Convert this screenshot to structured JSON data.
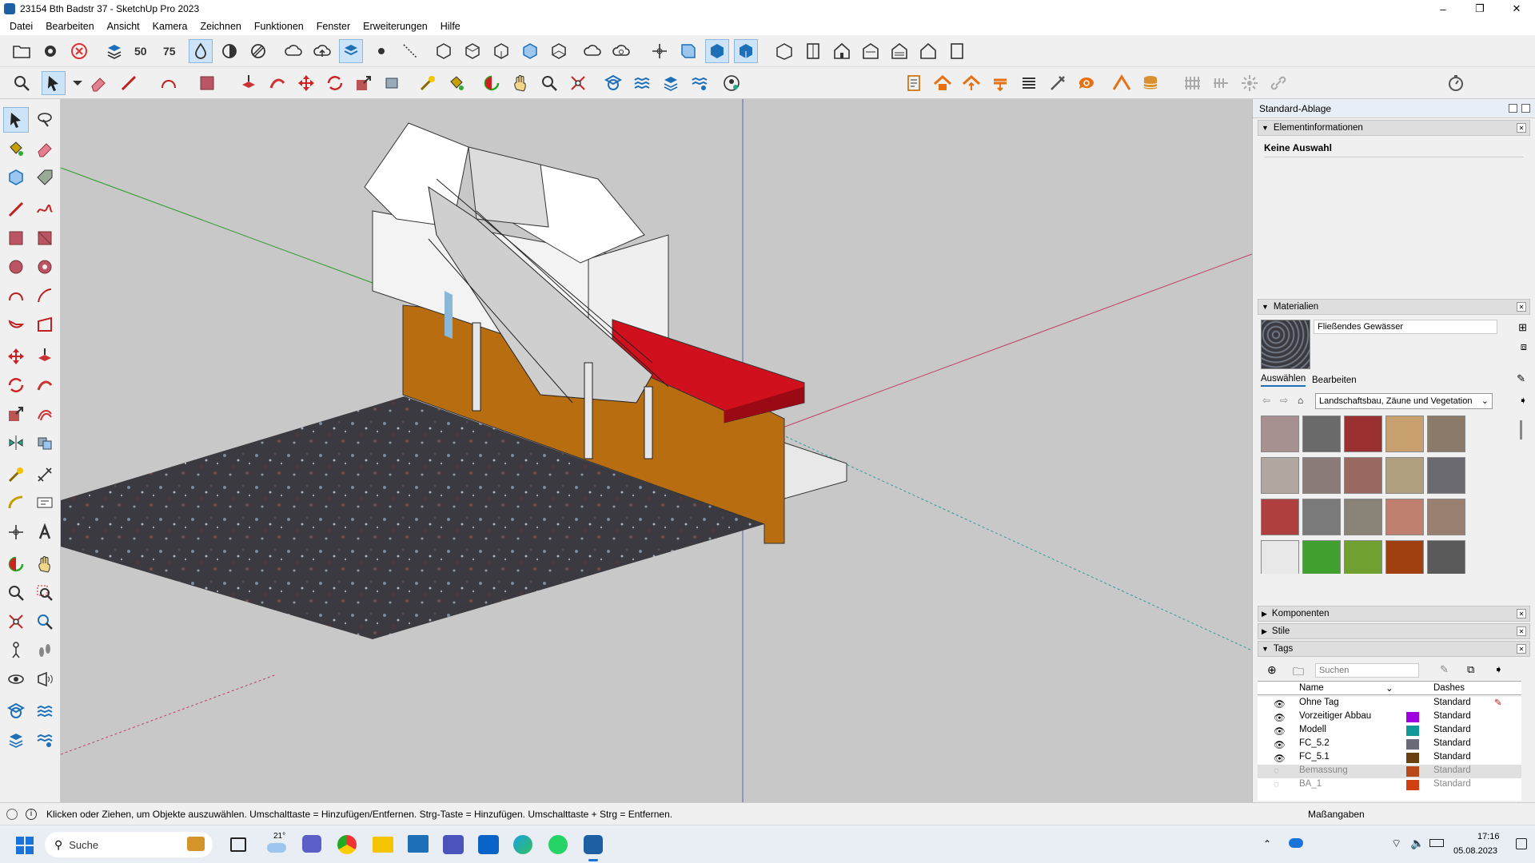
{
  "window": {
    "title": "23154 Bth Badstr 37 - SketchUp Pro 2023",
    "minimize": "–",
    "maximize": "❐",
    "close": "✕"
  },
  "menu": [
    "Datei",
    "Bearbeiten",
    "Ansicht",
    "Kamera",
    "Zeichnen",
    "Funktionen",
    "Fenster",
    "Erweiterungen",
    "Hilfe"
  ],
  "toolbar1": {
    "text_50": "50",
    "text_75": "75"
  },
  "tray": {
    "title": "Standard-Ablage",
    "entity_info": {
      "header": "Elementinformationen",
      "selection": "Keine Auswahl"
    },
    "materials": {
      "header": "Materialien",
      "current_name": "Fließendes Gewässer",
      "tab_select": "Auswählen",
      "tab_edit": "Bearbeiten",
      "library": "Landschaftsbau, Zäune und Vegetation"
    },
    "components": "Komponenten",
    "styles": "Stile",
    "tags": {
      "header": "Tags",
      "search_placeholder": "Suchen",
      "col_name": "Name",
      "col_dashes": "Dashes",
      "rows": [
        {
          "name": "Ohne Tag",
          "color": "",
          "dashes": "Standard",
          "visible": true
        },
        {
          "name": "Vorzeitiger Abbau",
          "color": "#a000e0",
          "dashes": "Standard",
          "visible": true
        },
        {
          "name": "Modell",
          "color": "#109898",
          "dashes": "Standard",
          "visible": true
        },
        {
          "name": "FC_5.2",
          "color": "#6a6a7a",
          "dashes": "Standard",
          "visible": true
        },
        {
          "name": "FC_5.1",
          "color": "#6a4010",
          "dashes": "Standard",
          "visible": true
        },
        {
          "name": "Bemassung",
          "color": "#b84818",
          "dashes": "Standard",
          "visible": false
        },
        {
          "name": "BA_1",
          "color": "#d04010",
          "dashes": "Standard",
          "visible": false
        }
      ]
    }
  },
  "status": {
    "message": "Klicken oder Ziehen, um Objekte auszuwählen. Umschalttaste = Hinzufügen/Entfernen. Strg-Taste = Hinzufügen. Umschalttaste + Strg = Entfernen.",
    "measurements_label": "Maßangaben"
  },
  "taskbar": {
    "search_placeholder": "Suche",
    "weather": "21°",
    "time": "17:16",
    "date": "05.08.2023"
  },
  "colors": {
    "accent_blue": "#1d6fb8",
    "viewport_bg": "#c8c8c8",
    "wall_orange": "#b86e10",
    "platform_red": "#d0101c"
  }
}
